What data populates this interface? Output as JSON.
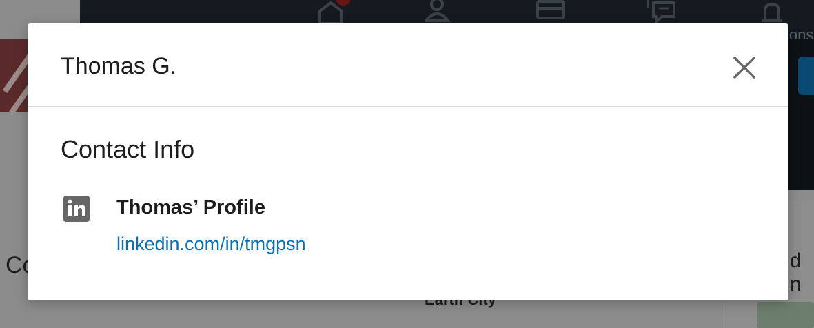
{
  "background": {
    "nav_label_fragment": "ions",
    "left_text_fragment": "Co",
    "right_text_fragment": "d n",
    "bottom_text_fragment": "Earth City"
  },
  "modal": {
    "title": "Thomas G.",
    "close_icon": "close-icon",
    "section_heading": "Contact Info",
    "profile": {
      "icon": "linkedin-icon",
      "title": "Thomas’ Profile",
      "link_text": "linkedin.com/in/tmgpsn"
    }
  },
  "colors": {
    "link": "#0a70b8",
    "linkedin_icon": "#666666",
    "close_icon": "#666666",
    "overlay_bg": "#8c8c8c",
    "nav_dark": "#141a20"
  }
}
